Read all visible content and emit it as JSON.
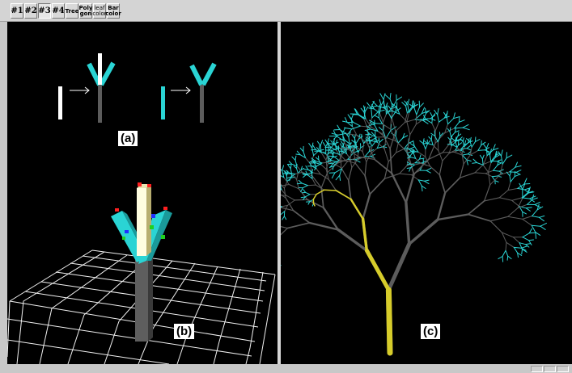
{
  "toolbar": {
    "buttons": [
      {
        "label": "#1"
      },
      {
        "label": "#2"
      },
      {
        "label": "#3"
      },
      {
        "label": "#4"
      },
      {
        "label": "Tree"
      },
      {
        "line1": "Poly",
        "line2": "gon"
      },
      {
        "line1": "leaf",
        "line2": "color"
      },
      {
        "line1": "Bar",
        "line2": "color"
      }
    ]
  },
  "panels": {
    "left": {
      "label_a": "(a)",
      "label_b": "(b)"
    },
    "right": {
      "label_c": "(c)"
    }
  },
  "colors": {
    "background": "#000000",
    "leaf": "#2ad4d4",
    "branch": "#5c5c5c",
    "highlight_branch": "#d6cc2a",
    "grid": "#ffffff",
    "bar_front": "#fffde0"
  }
}
